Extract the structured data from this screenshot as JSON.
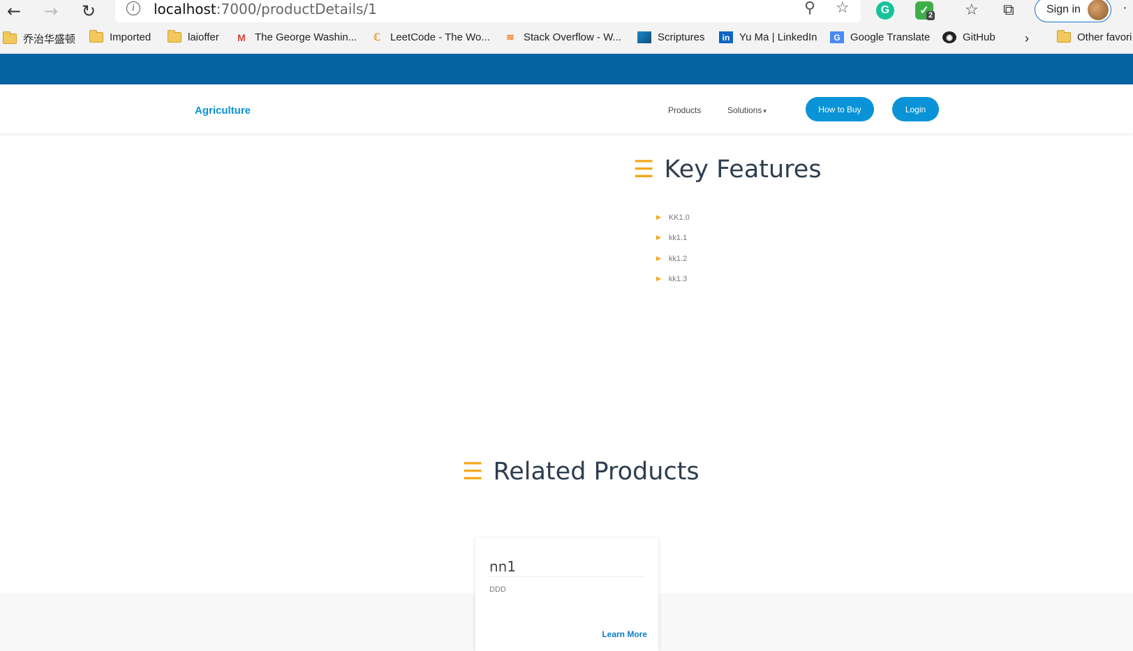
{
  "browser": {
    "url_host": "localhost",
    "url_path": ":7000/productDetails/1",
    "extension_badge": "2",
    "signin_label": "Sign in",
    "more_label": "·"
  },
  "bookmarks": [
    {
      "label": "乔治华盛顿",
      "icon": "folder-icon"
    },
    {
      "label": "Imported",
      "icon": "folder-icon"
    },
    {
      "label": "laioffer",
      "icon": "folder-icon"
    },
    {
      "label": "The George Washin...",
      "icon": "gmail-icon"
    },
    {
      "label": "LeetCode - The Wo...",
      "icon": "leetcode-icon"
    },
    {
      "label": "Stack Overflow - W...",
      "icon": "stackoverflow-icon"
    },
    {
      "label": "Scriptures",
      "icon": "scriptures-icon"
    },
    {
      "label": "Yu Ma | LinkedIn",
      "icon": "linkedin-icon"
    },
    {
      "label": "Google Translate",
      "icon": "translate-icon"
    },
    {
      "label": "GitHub",
      "icon": "github-icon"
    }
  ],
  "other_favorites": "Other favori",
  "site": {
    "brand": "Agriculture",
    "nav": {
      "products": "Products",
      "solutions": "Solutions",
      "how_to_buy": "How to Buy",
      "login": "Login"
    },
    "key_features": {
      "title": "Key Features",
      "items": [
        "KK1.0",
        "kk1.1",
        "kk1.2",
        "kk1.3"
      ]
    },
    "related_products": {
      "title": "Related Products",
      "card": {
        "title": "nn1",
        "description": "DDD",
        "link": "Learn More"
      }
    }
  },
  "colors": {
    "top_bar": "#0563a4",
    "accent_blue": "#0a93d6",
    "accent_orange": "#f4a81b"
  }
}
